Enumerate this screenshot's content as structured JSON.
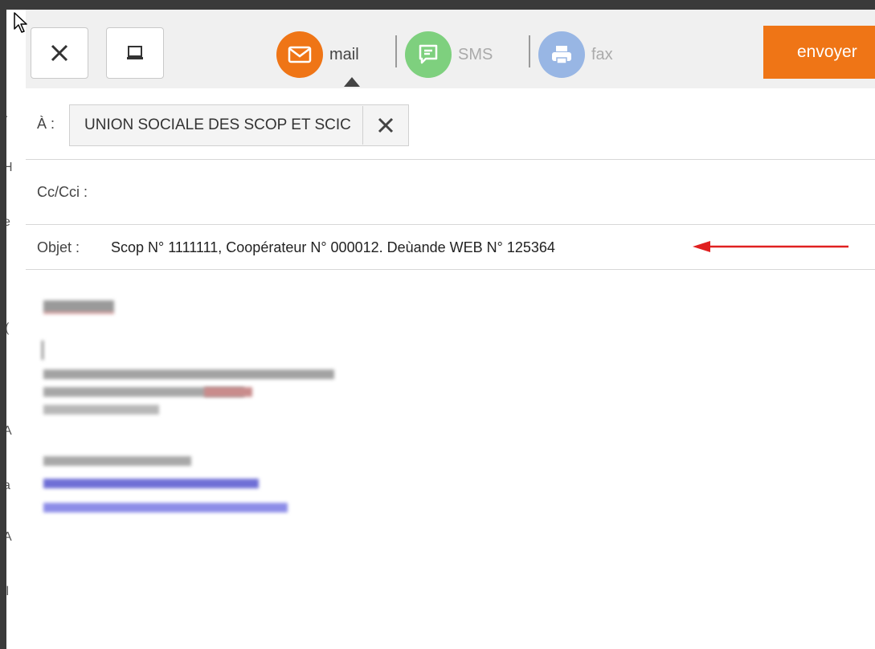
{
  "toolbar": {
    "close_icon": "close-icon",
    "window_icon": "window-icon",
    "channels": [
      {
        "label": "mail",
        "icon": "envelope-icon",
        "color": "#ef7516",
        "active": true
      },
      {
        "label": "SMS",
        "icon": "chat-icon",
        "color": "#7ed07e",
        "active": false
      },
      {
        "label": "fax",
        "icon": "printer-icon",
        "color": "#98b6e4",
        "active": false
      }
    ],
    "send_label": "envoyer",
    "send_color": "#ef7516"
  },
  "to": {
    "label": "À :",
    "recipient": "UNION SOCIALE DES SCOP ET SCIC"
  },
  "cc": {
    "label": "Cc/Cci :"
  },
  "subject": {
    "label": "Objet :",
    "value": "Scop N° 1111111, Coopérateur N° 000012. Deùande WEB N° 125364"
  },
  "annotation": {
    "arrow_color": "#e02020"
  }
}
